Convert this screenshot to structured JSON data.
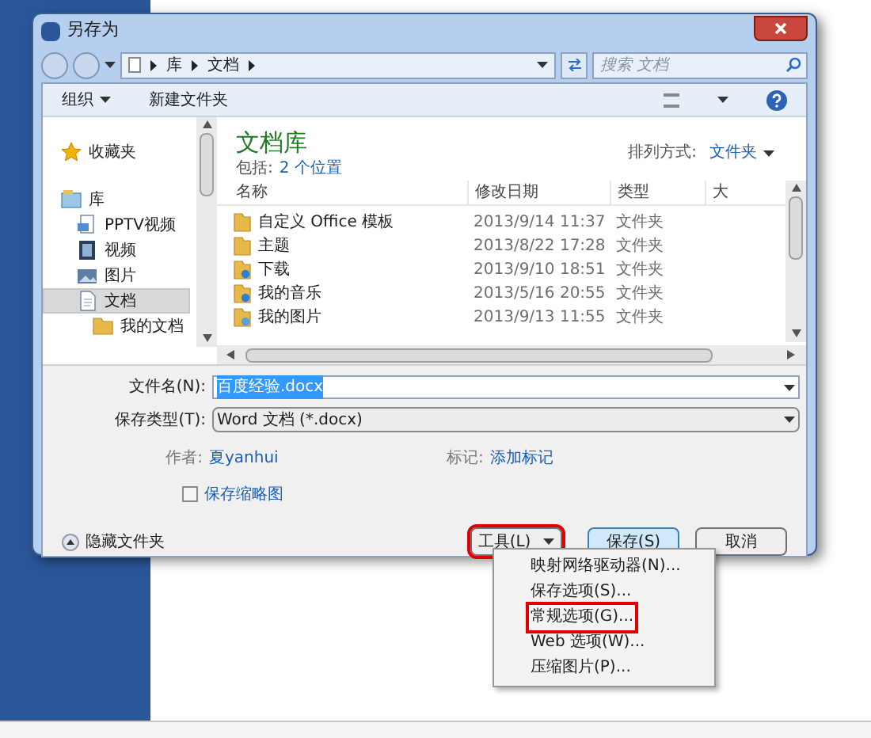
{
  "window": {
    "title": "另存为"
  },
  "address": {
    "path": [
      "库",
      "文档"
    ],
    "search_placeholder": "搜索 文档"
  },
  "toolbar": {
    "organize": "组织",
    "new_folder": "新建文件夹"
  },
  "nav": [
    {
      "label": "收藏夹",
      "kind": "favorites",
      "selected": false
    },
    {
      "label": "库",
      "kind": "library",
      "selected": false,
      "children": [
        {
          "label": "PPTV视频",
          "kind": "file",
          "selected": false
        },
        {
          "label": "视频",
          "kind": "video",
          "selected": false
        },
        {
          "label": "图片",
          "kind": "picture",
          "selected": false
        },
        {
          "label": "文档",
          "kind": "document",
          "selected": true,
          "children": [
            {
              "label": "我的文档",
              "kind": "folder",
              "selected": false
            }
          ]
        }
      ]
    }
  ],
  "library": {
    "title": "文档库",
    "includes_label": "包括:",
    "includes_link": "2 个位置",
    "arrange_label": "排列方式:",
    "arrange_value": "文件夹"
  },
  "table": {
    "columns": [
      "名称",
      "修改日期",
      "类型",
      "大"
    ],
    "rows": [
      {
        "name": "自定义 Office 模板",
        "modified": "2013/9/14 11:37",
        "type": "文件夹",
        "kind": "folder"
      },
      {
        "name": "主题",
        "modified": "2013/8/22 17:28",
        "type": "文件夹",
        "kind": "folder"
      },
      {
        "name": "下载",
        "modified": "2013/9/10 18:51",
        "type": "文件夹",
        "kind": "download"
      },
      {
        "name": "我的音乐",
        "modified": "2013/5/16 20:55",
        "type": "文件夹",
        "kind": "music"
      },
      {
        "name": "我的图片",
        "modified": "2013/9/13 11:55",
        "type": "文件夹",
        "kind": "pictures"
      }
    ]
  },
  "form": {
    "filename_label": "文件名(N):",
    "filename": "百度经验.docx",
    "filename_selected": true,
    "type_label": "保存类型(T):",
    "type": "Word 文档 (*.docx)",
    "author_label": "作者:",
    "author": "夏yanhui",
    "tags_label": "标记:",
    "tags": "添加标记",
    "thumbnail_label": "保存缩略图",
    "thumbnail_checked": false
  },
  "footer": {
    "hide_folders": "隐藏文件夹",
    "buttons": [
      {
        "label": "工具(L)",
        "kind": "menu",
        "highlighted": true
      },
      {
        "label": "保存(S)",
        "kind": "default",
        "highlighted": false
      },
      {
        "label": "取消",
        "kind": "plain",
        "highlighted": false
      }
    ]
  },
  "menu": [
    {
      "label": "映射网络驱动器(N)...",
      "highlighted": false
    },
    {
      "label": "保存选项(S)...",
      "highlighted": false
    },
    {
      "label": "常规选项(G)...",
      "highlighted": true
    },
    {
      "label": "Web 选项(W)...",
      "highlighted": false
    },
    {
      "label": "压缩图片(P)...",
      "highlighted": false
    }
  ]
}
